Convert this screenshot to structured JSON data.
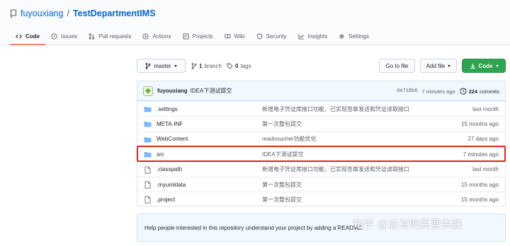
{
  "repo": {
    "owner": "fuyouxiang",
    "separator": "/",
    "name": "TestDepartmentIMS"
  },
  "tabs": [
    {
      "label": "Code",
      "icon": "code-icon",
      "active": true
    },
    {
      "label": "Issues",
      "icon": "issue-icon"
    },
    {
      "label": "Pull requests",
      "icon": "pull-request-icon"
    },
    {
      "label": "Actions",
      "icon": "play-icon"
    },
    {
      "label": "Projects",
      "icon": "project-icon"
    },
    {
      "label": "Wiki",
      "icon": "book-icon"
    },
    {
      "label": "Security",
      "icon": "shield-icon"
    },
    {
      "label": "Insights",
      "icon": "graph-icon"
    },
    {
      "label": "Settings",
      "icon": "gear-icon"
    }
  ],
  "toolbar": {
    "branch_button": "master",
    "branch_count": "1",
    "branch_label": "branch",
    "tag_count": "0",
    "tag_label": "tags",
    "goto_file": "Go to file",
    "add_file": "Add file",
    "code_button": "Code"
  },
  "commit": {
    "author": "fuyouxiang",
    "message": "IDEA下测试提交",
    "sha": "de718b6",
    "time": "7 minutes ago",
    "count": "224",
    "count_label": "commits"
  },
  "files": [
    {
      "name": ".settings",
      "type": "folder",
      "message": "新增电子凭证库接口功能，已实现签章发送和凭证读取接口",
      "age": "last month"
    },
    {
      "name": "META-INF",
      "type": "folder",
      "message": "第一次整包提交",
      "age": "15 months ago"
    },
    {
      "name": "WebContent",
      "type": "folder",
      "message": "readvoucher功能优化",
      "age": "27 days ago"
    },
    {
      "name": "src",
      "type": "folder",
      "message": "IDEA下测试提交",
      "age": "7 minutes ago"
    },
    {
      "name": ".classpath",
      "type": "file",
      "message": "新增电子凭证库接口功能，已实现签章发送和凭证读取接口",
      "age": "last month"
    },
    {
      "name": ".myumldata",
      "type": "file",
      "message": "第一次整包提交",
      "age": "15 months ago"
    },
    {
      "name": ".project",
      "type": "file",
      "message": "第一次整包提交",
      "age": "15 months ago"
    }
  ],
  "readme_prompt": "Help people interested in this repository understand your project by adding a README.",
  "watermark": "知乎 @总有贱民要杀朕",
  "colors": {
    "link": "#0366d6",
    "folder": "#79b8ff",
    "green_button": "#2ea44f",
    "highlight": "#e0271a",
    "tab_underline": "#f9826c"
  }
}
